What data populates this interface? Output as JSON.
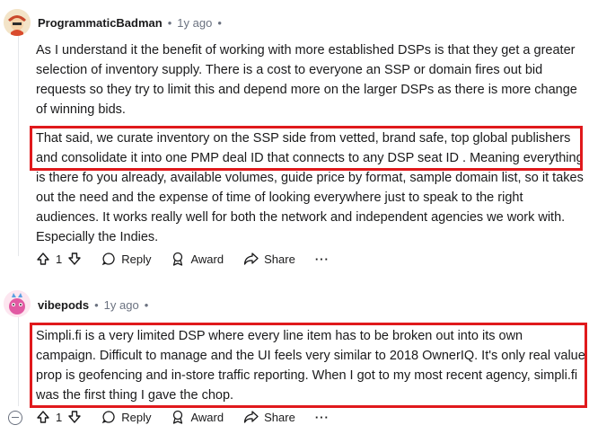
{
  "comments": [
    {
      "username": "ProgrammaticBadman",
      "separator": "•",
      "time": "1y ago",
      "dot_after": "•",
      "paragraph1": "As I understand it the benefit of working with more established DSPs is that they get a greater selection of inventory supply. There is a cost to everyone an SSP or domain fires out bid requests so they try to limit this and depend more on the larger DSPs as there is more change of winning bids.",
      "paragraph2": "That said, we curate inventory on the SSP side from vetted, brand safe, top global publishers and consolidate it into one PMP deal ID that connects to any DSP seat ID . Meaning everything is there fo you already, available volumes, guide price by format, sample domain list, so it takes out the need and the expense of time of looking everywhere just to speak to the right audiences. It works really well for both the network and independent agencies we work with. Especially the Indies.",
      "vote_count": "1",
      "reply_label": "Reply",
      "award_label": "Award",
      "share_label": "Share",
      "more_label": "···"
    },
    {
      "username": "vibepods",
      "separator": "•",
      "time": "1y ago",
      "dot_after": "•",
      "paragraph1": "Simpli.fi is a very limited DSP where every line item has to be broken out into its own campaign. Difficult to manage and the UI feels very similar to 2018 OwnerIQ. It's only real value prop is geofencing and in-store traffic reporting. When I got to my most recent agency, simpli.fi was the first thing I gave the chop.",
      "vote_count": "1",
      "reply_label": "Reply",
      "award_label": "Award",
      "share_label": "Share",
      "more_label": "···"
    }
  ],
  "colors": {
    "highlight": "#e0191c",
    "meta": "#6b7280",
    "thread_line": "#e5e7eb"
  }
}
